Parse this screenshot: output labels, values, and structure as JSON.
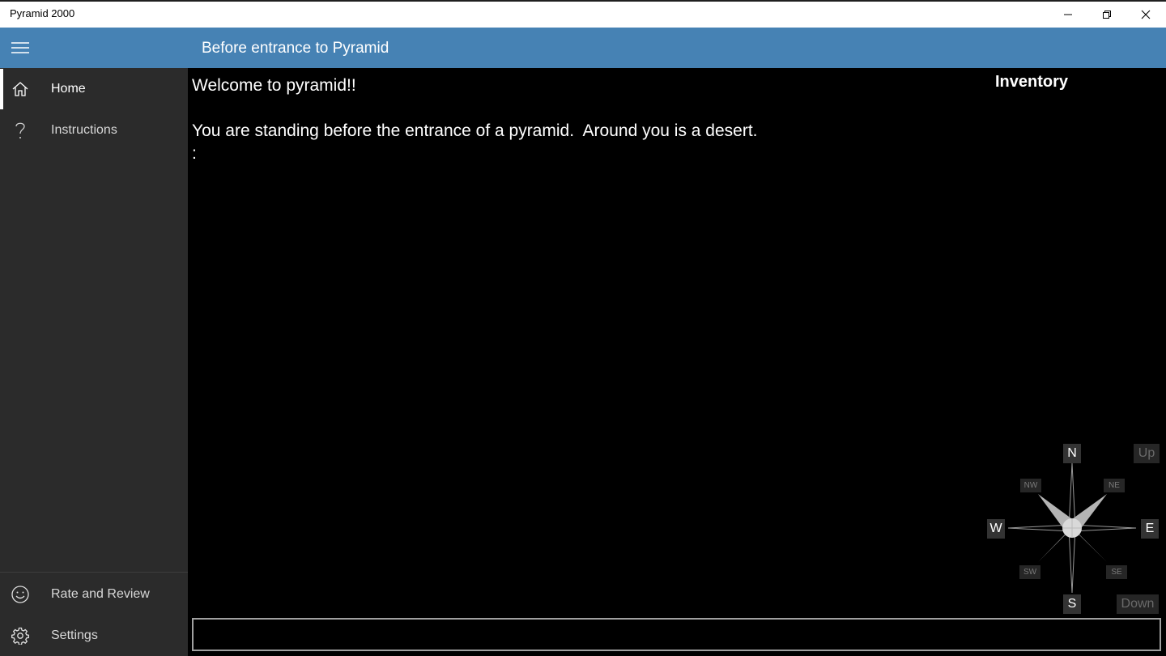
{
  "window": {
    "title": "Pyramid 2000"
  },
  "header": {
    "title": "Before entrance to Pyramid"
  },
  "sidebar": {
    "items": [
      {
        "label": "Home",
        "icon": "home-icon",
        "selected": true
      },
      {
        "label": "Instructions",
        "icon": "question-icon",
        "selected": false
      }
    ],
    "bottom_items": [
      {
        "label": "Rate and Review",
        "icon": "smiley-icon"
      },
      {
        "label": "Settings",
        "icon": "gear-icon"
      }
    ]
  },
  "game": {
    "output": "Welcome to pyramid!!\n\nYou are standing before the entrance of a pyramid.  Around you is a desert.\n:",
    "inventory_title": "Inventory",
    "command_value": ""
  },
  "compass": {
    "n": "N",
    "s": "S",
    "e": "E",
    "w": "W",
    "ne": "NE",
    "nw": "NW",
    "se": "SE",
    "sw": "SW",
    "up": "Up",
    "down": "Down"
  },
  "colors": {
    "accent": "#4682b4",
    "sidebar_bg": "#2b2b2b",
    "main_bg": "#000000"
  }
}
